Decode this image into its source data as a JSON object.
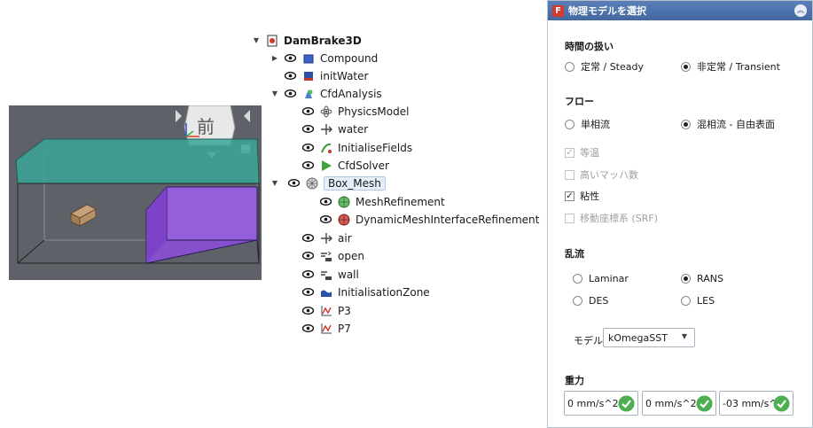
{
  "tree": {
    "root": "DamBrake3D",
    "items": [
      "Compound",
      "initWater",
      "CfdAnalysis",
      "PhysicsModel",
      "water",
      "InitialiseFields",
      "CfdSolver",
      "Box_Mesh",
      "MeshRefinement",
      "DynamicMeshInterfaceRefinement",
      "air",
      "open",
      "wall",
      "InitialisationZone",
      "P3",
      "P7"
    ]
  },
  "viewport": {
    "navcube_face": "前"
  },
  "panel": {
    "title": "物理モデルを選択",
    "logo_letter": "F",
    "time": {
      "title": "時間の扱い",
      "steady": "定常 / Steady",
      "transient": "非定常 / Transient",
      "selected": "transient"
    },
    "flow": {
      "title": "フロー",
      "single": "単相流",
      "multi": "混相流 - 自由表面",
      "selected": "multi"
    },
    "options": {
      "isothermal": "等温",
      "high_mach": "高いマッハ数",
      "viscous": "粘性",
      "srf": "移動座標系 (SRF)"
    },
    "turbulence": {
      "title": "乱流",
      "laminar": "Laminar",
      "rans": "RANS",
      "des": "DES",
      "les": "LES",
      "selected": "rans"
    },
    "model": {
      "label": "モデル",
      "value": "kOmegaSST"
    },
    "gravity": {
      "title": "重力",
      "x": "0 mm/s^2",
      "y": "0 mm/s^2",
      "z": "-03 mm/s^2"
    }
  },
  "colors": {
    "title_bar": "#4a6ea8",
    "viewport_bg": "#5f6169",
    "water_box": "#8a4fd6",
    "top_plane": "#3aa596",
    "ok_green": "#4caf50"
  }
}
